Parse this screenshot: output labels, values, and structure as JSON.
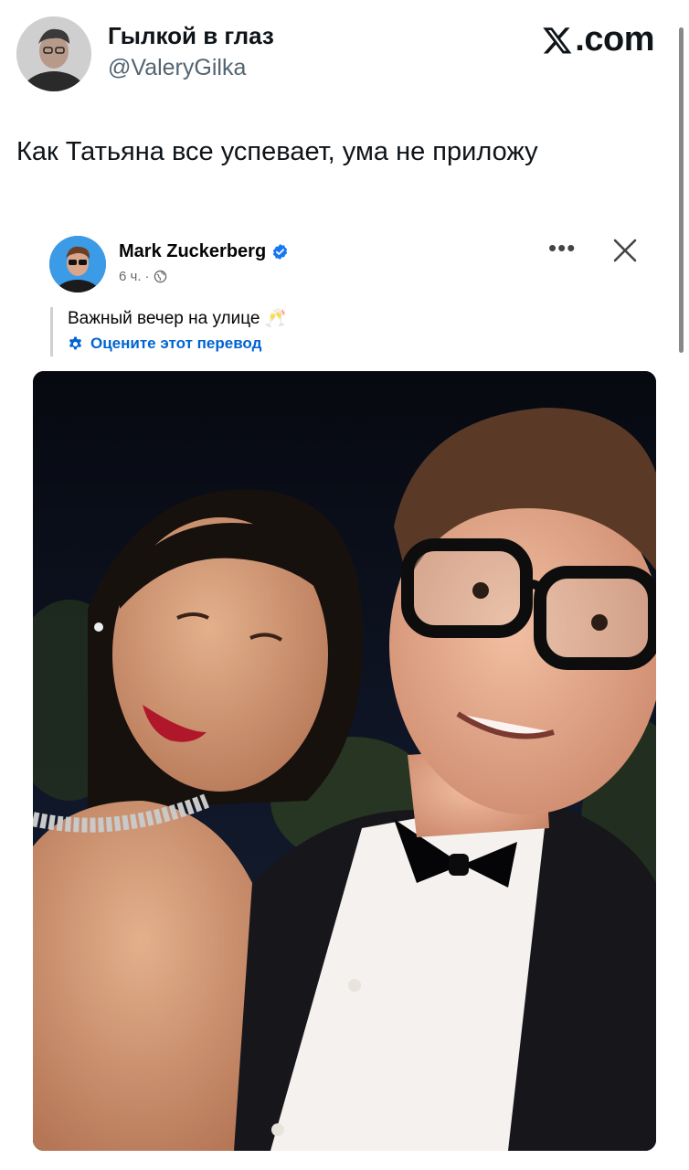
{
  "tweet": {
    "author_name": "Гылкой в глаз",
    "author_handle": "@ValeryGilka",
    "brand": ".com",
    "text": "Как Татьяна все успевает, ума не приложу"
  },
  "embedded_post": {
    "author_name": "Mark Zuckerberg",
    "time": "6 ч.",
    "separator": "·",
    "caption": "Важный вечер на улице 🥂",
    "translate_link": "Оцените этот перевод",
    "more_label": "•••",
    "icons": [
      "verified-badge-icon",
      "globe-icon",
      "more-options-icon",
      "close-icon",
      "gear-icon"
    ]
  },
  "colors": {
    "link": "#0064d1",
    "verified": "#1877f2",
    "muted": "#65676b",
    "handle": "#536471"
  }
}
